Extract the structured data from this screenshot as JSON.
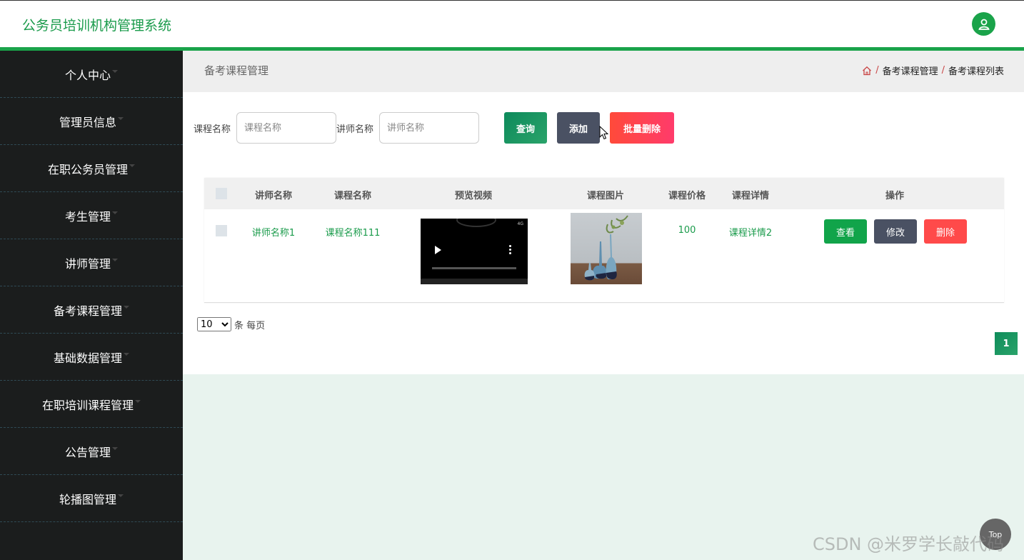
{
  "header": {
    "title": "公务员培训机构管理系统",
    "avatar_icon": "user-icon",
    "accent": "#1aa34a"
  },
  "sidebar": {
    "items": [
      {
        "label": "个人中心"
      },
      {
        "label": "管理员信息"
      },
      {
        "label": "在职公务员管理"
      },
      {
        "label": "考生管理"
      },
      {
        "label": "讲师管理"
      },
      {
        "label": "备考课程管理"
      },
      {
        "label": "基础数据管理"
      },
      {
        "label": "在职培训课程管理"
      },
      {
        "label": "公告管理"
      },
      {
        "label": "轮播图管理"
      }
    ]
  },
  "page": {
    "title": "备考课程管理",
    "breadcrumb": [
      "备考课程管理",
      "备考课程列表"
    ],
    "breadcrumb_sep": "/"
  },
  "search": {
    "course_label": "课程名称",
    "course_placeholder": "课程名称",
    "teacher_label": "讲师名称",
    "teacher_placeholder": "讲师名称",
    "query_label": "查询",
    "add_label": "添加",
    "batch_delete_label": "批量删除"
  },
  "table": {
    "headers": [
      "讲师名称",
      "课程名称",
      "预览视频",
      "课程图片",
      "课程价格",
      "课程详情",
      "操作"
    ],
    "rows": [
      {
        "teacher": "讲师名称1",
        "course": "课程名称111",
        "price": "100",
        "detail": "课程详情2",
        "video_status": "4G",
        "actions": {
          "view": "查看",
          "edit": "修改",
          "delete": "删除"
        }
      }
    ]
  },
  "pagination": {
    "page_size": "10",
    "page_size_options": [
      "10"
    ],
    "page_size_suffix": "条 每页",
    "current_page": "1"
  },
  "top_button": "Top",
  "watermark": "CSDN @米罗学长敲代码"
}
